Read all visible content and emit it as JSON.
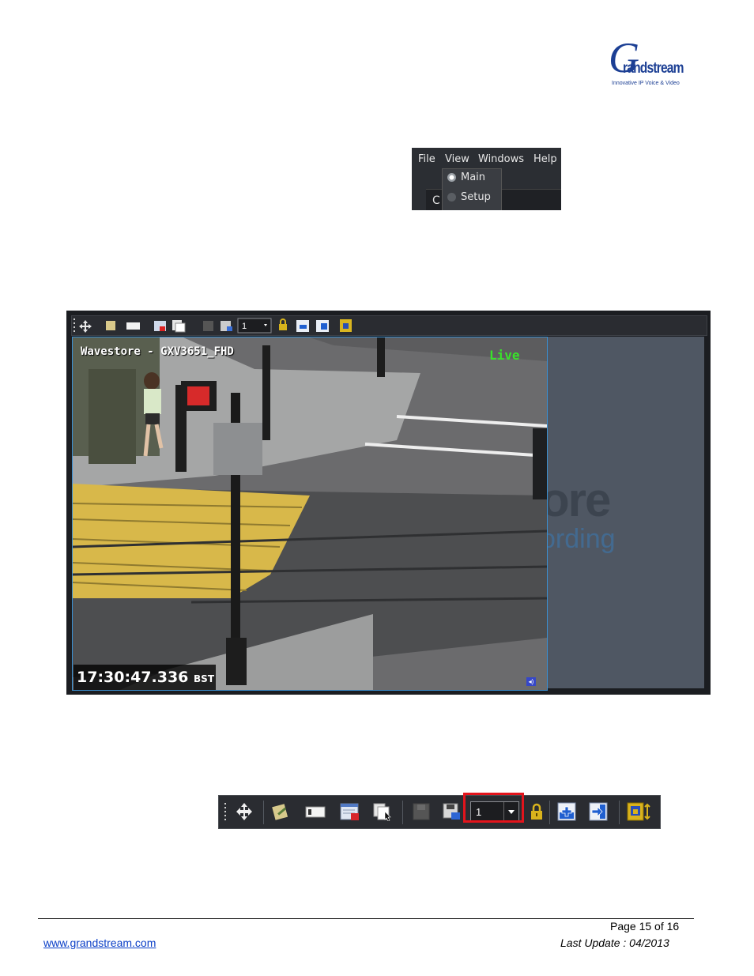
{
  "logo": {
    "initial": "G",
    "word": "randstream",
    "tagline": "Innovative IP Voice & Video"
  },
  "view_menu": {
    "menubar": [
      "File",
      "View",
      "Windows",
      "Help"
    ],
    "dropdown": [
      {
        "label": "Main",
        "selected": true
      },
      {
        "label": "Setup",
        "selected": false
      }
    ],
    "below_text": "C"
  },
  "viewer": {
    "camera_title": "Wavestore - GXV3651_FHD",
    "live_label": "Live",
    "time": "17:30:47.336",
    "timezone": "BST",
    "toolbar_select_value": "1",
    "background_brand_partial_1": "ore",
    "background_brand_partial_2": "ording"
  },
  "toolbar": {
    "select_value": "1",
    "icons": [
      "drag-handle-icon",
      "move-icon",
      "edit-icon",
      "window-icon",
      "close-layout-icon",
      "copy-layout-icon",
      "record-icon",
      "save-icon",
      "lock-icon",
      "add-view-icon",
      "export-view-icon",
      "alarm-icon"
    ],
    "highlight_color": "#e3141c"
  },
  "footer": {
    "page": "Page 15 of 16",
    "link": "www.grandstream.com",
    "last_update": "Last Update : 04/2013"
  }
}
